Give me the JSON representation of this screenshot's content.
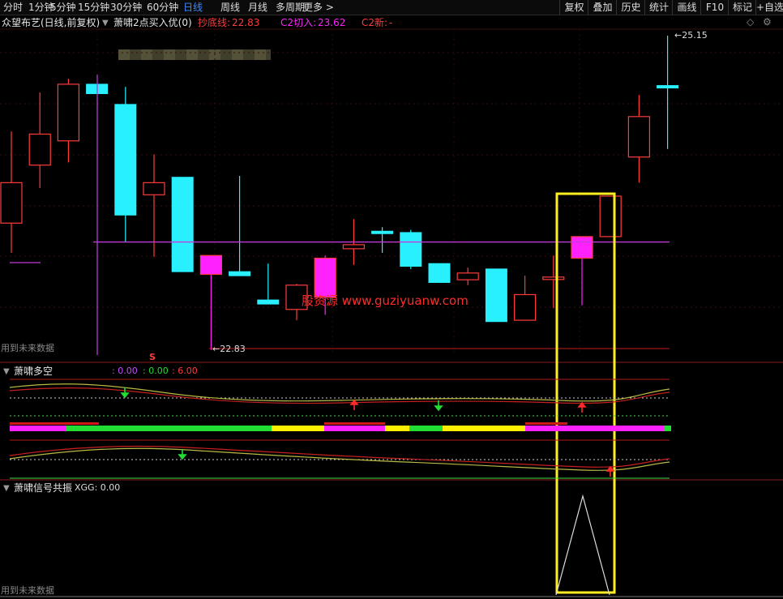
{
  "toolbar": {
    "periods": [
      "分时",
      "1分钟",
      "5分钟",
      "15分钟",
      "30分钟",
      "60分钟",
      "日线",
      "周线",
      "月线",
      "多周期",
      "更多 >"
    ],
    "active_period": "日线",
    "right_buttons": [
      "复权",
      "叠加",
      "历史",
      "统计",
      "画线",
      "F10",
      "标记",
      "+自选"
    ]
  },
  "chart_header": {
    "stock_title": "众望布艺(日线,前复权)",
    "indicator_name": "萧啸2点买入优(0)",
    "bottom_line_label": "抄底线:",
    "bottom_line_value": "22.83",
    "c2_entry_label": "C2切入:",
    "c2_entry_value": "23.62",
    "c2_new_label": "C2新:",
    "c2_new_value": "-",
    "future_data_note": "用到未来数据",
    "high_marker": "25.15",
    "low_marker": "22.83",
    "signal_glyph": "S"
  },
  "panel2": {
    "title": "萧啸多空",
    "v1": ": 0.00",
    "v2": ": 0.00",
    "v3": ": 6.00"
  },
  "panel3": {
    "title": "萧啸信号共振",
    "xgg_label": "XGG: 0.00",
    "future_data_note": "用到未来数据"
  },
  "watermark": "股资源 www.guziyuanw.com",
  "colors": {
    "up": "#ff3b3b",
    "down": "#29f0ff",
    "magenta": "#ff22ff",
    "highlight_box": "#ffee22",
    "green": "#22dd33",
    "yellow": "#ffee00"
  },
  "chart_data": {
    "type": "candlestick",
    "price_range": [
      22.3,
      25.5
    ],
    "candles": [
      {
        "o": 23.76,
        "h": 24.44,
        "l": 23.54,
        "c": 24.06,
        "style": "up"
      },
      {
        "o": 24.19,
        "h": 24.73,
        "l": 24.02,
        "c": 24.42,
        "style": "up"
      },
      {
        "o": 24.37,
        "h": 24.83,
        "l": 24.21,
        "c": 24.79,
        "style": "up"
      },
      {
        "o": 24.79,
        "h": 24.79,
        "l": 24.72,
        "c": 24.72,
        "style": "down"
      },
      {
        "o": 24.64,
        "h": 24.77,
        "l": 23.62,
        "c": 23.82,
        "style": "down"
      },
      {
        "o": 23.97,
        "h": 24.27,
        "l": 23.51,
        "c": 24.06,
        "style": "up"
      },
      {
        "o": 24.1,
        "h": 24.1,
        "l": 23.4,
        "c": 23.4,
        "style": "down"
      },
      {
        "o": 23.52,
        "h": 23.52,
        "l": 22.82,
        "c": 23.38,
        "style": "magenta"
      },
      {
        "o": 23.4,
        "h": 24.11,
        "l": 23.37,
        "c": 23.37,
        "style": "down"
      },
      {
        "o": 23.19,
        "h": 23.46,
        "l": 23.16,
        "c": 23.16,
        "style": "down"
      },
      {
        "o": 23.12,
        "h": 23.31,
        "l": 23.04,
        "c": 23.3,
        "style": "up"
      },
      {
        "o": 23.21,
        "h": 23.52,
        "l": 23.08,
        "c": 23.5,
        "style": "magenta"
      },
      {
        "o": 23.57,
        "h": 23.79,
        "l": 23.45,
        "c": 23.6,
        "style": "up"
      },
      {
        "o": 23.7,
        "h": 23.73,
        "l": 23.54,
        "c": 23.7,
        "style": "down"
      },
      {
        "o": 23.69,
        "h": 23.71,
        "l": 23.42,
        "c": 23.44,
        "style": "down"
      },
      {
        "o": 23.46,
        "h": 23.46,
        "l": 23.32,
        "c": 23.32,
        "style": "down"
      },
      {
        "o": 23.34,
        "h": 23.43,
        "l": 23.3,
        "c": 23.39,
        "style": "up"
      },
      {
        "o": 23.42,
        "h": 23.42,
        "l": 23.03,
        "c": 23.03,
        "style": "down"
      },
      {
        "o": 23.04,
        "h": 23.37,
        "l": 23.04,
        "c": 23.23,
        "style": "up"
      },
      {
        "o": 23.36,
        "h": 23.52,
        "l": 23.13,
        "c": 23.36,
        "style": "up"
      },
      {
        "o": 23.5,
        "h": 23.66,
        "l": 23.15,
        "c": 23.66,
        "style": "magenta"
      },
      {
        "o": 23.66,
        "h": 23.96,
        "l": 23.66,
        "c": 23.96,
        "style": "up"
      },
      {
        "o": 24.25,
        "h": 24.71,
        "l": 24.06,
        "c": 24.55,
        "style": "up"
      },
      {
        "o": 24.78,
        "h": 25.15,
        "l": 24.31,
        "c": 24.78,
        "style": "down"
      }
    ],
    "horizontal_lines": [
      {
        "name": "抄底线",
        "value": 22.83
      },
      {
        "name": "C2切入",
        "value": 23.62
      }
    ]
  }
}
